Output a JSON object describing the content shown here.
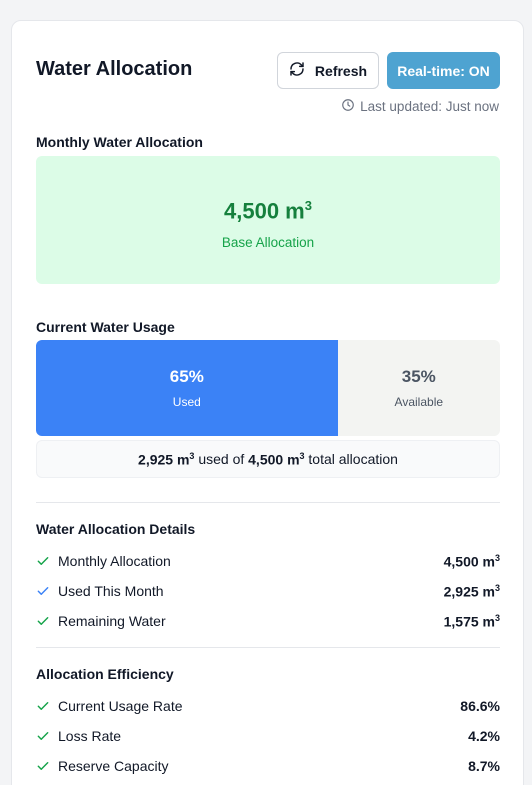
{
  "header": {
    "title": "Water Allocation",
    "refresh_label": "Refresh",
    "realtime_label": "Real-time: ON",
    "last_updated": "Last updated: Just now"
  },
  "monthly_allocation": {
    "section_title": "Monthly Water Allocation",
    "value": "4,500 m",
    "unit_sup": "3",
    "label": "Base Allocation"
  },
  "usage": {
    "section_title": "Current Water Usage",
    "used_fraction": 0.65,
    "used_pct": "65%",
    "used_label": "Used",
    "available_pct": "35%",
    "available_label": "Available",
    "summary": {
      "used": "2,925 m",
      "used_sup": "3",
      "middle": " used of ",
      "total": "4,500 m",
      "total_sup": "3",
      "end": " total allocation"
    }
  },
  "details": {
    "section_title": "Water Allocation Details",
    "rows": [
      {
        "label": "Monthly Allocation",
        "value": "4,500 m",
        "sup": "3",
        "icon_color": "#16a34a"
      },
      {
        "label": "Used This Month",
        "value": "2,925 m",
        "sup": "3",
        "icon_color": "#3b82f6"
      },
      {
        "label": "Remaining Water",
        "value": "1,575 m",
        "sup": "3",
        "icon_color": "#16a34a"
      }
    ]
  },
  "efficiency": {
    "section_title": "Allocation Efficiency",
    "rows": [
      {
        "label": "Current Usage Rate",
        "value": "86.6%",
        "icon_color": "#16a34a"
      },
      {
        "label": "Loss Rate",
        "value": "4.2%",
        "icon_color": "#16a34a"
      },
      {
        "label": "Reserve Capacity",
        "value": "8.7%",
        "icon_color": "#16a34a"
      }
    ]
  },
  "colors": {
    "accent_blue": "#3b82f6",
    "realtime_button": "#4ea3d1",
    "allocation_bg": "#dcfce7",
    "allocation_text": "#15803d"
  },
  "icons": {
    "refresh": "refresh-icon",
    "clock": "clock-icon",
    "check": "check-icon"
  }
}
